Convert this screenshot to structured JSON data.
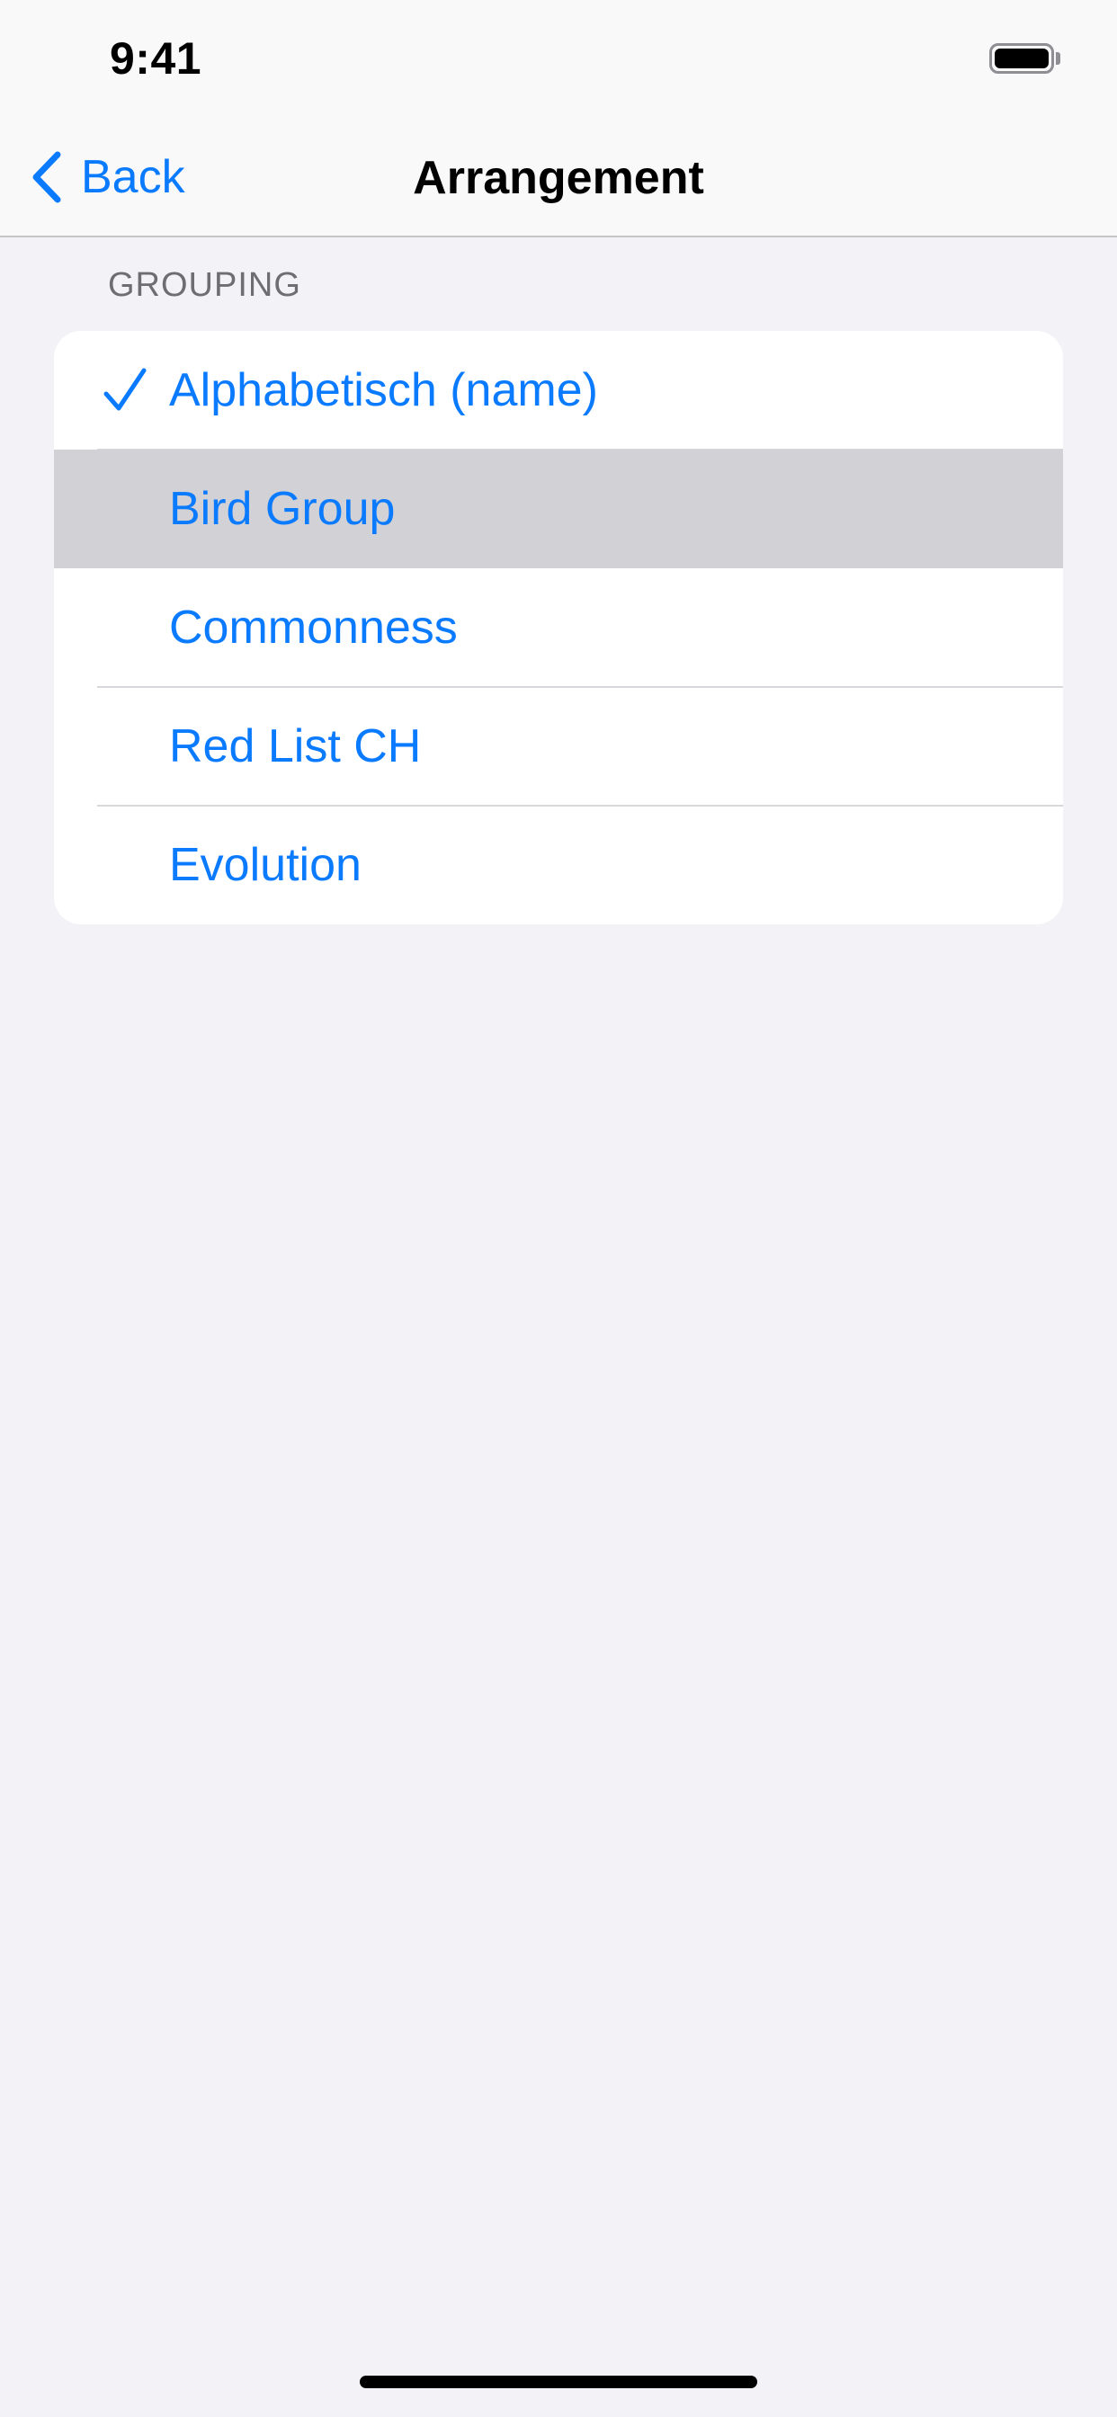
{
  "status_bar": {
    "time": "9:41"
  },
  "nav": {
    "back_label": "Back",
    "title": "Arrangement",
    "back_icon": "chevron-left-icon"
  },
  "section": {
    "header": "GROUPING"
  },
  "options": [
    {
      "label": "Alphabetisch (name)",
      "checked": true,
      "highlighted": false
    },
    {
      "label": "Bird Group",
      "checked": false,
      "highlighted": true
    },
    {
      "label": "Commonness",
      "checked": false,
      "highlighted": false
    },
    {
      "label": "Red List CH",
      "checked": false,
      "highlighted": false
    },
    {
      "label": "Evolution",
      "checked": false,
      "highlighted": false
    }
  ],
  "colors": {
    "accent": "#0a7aff",
    "background": "#f2f2f7",
    "highlight": "#d1d1d6"
  }
}
